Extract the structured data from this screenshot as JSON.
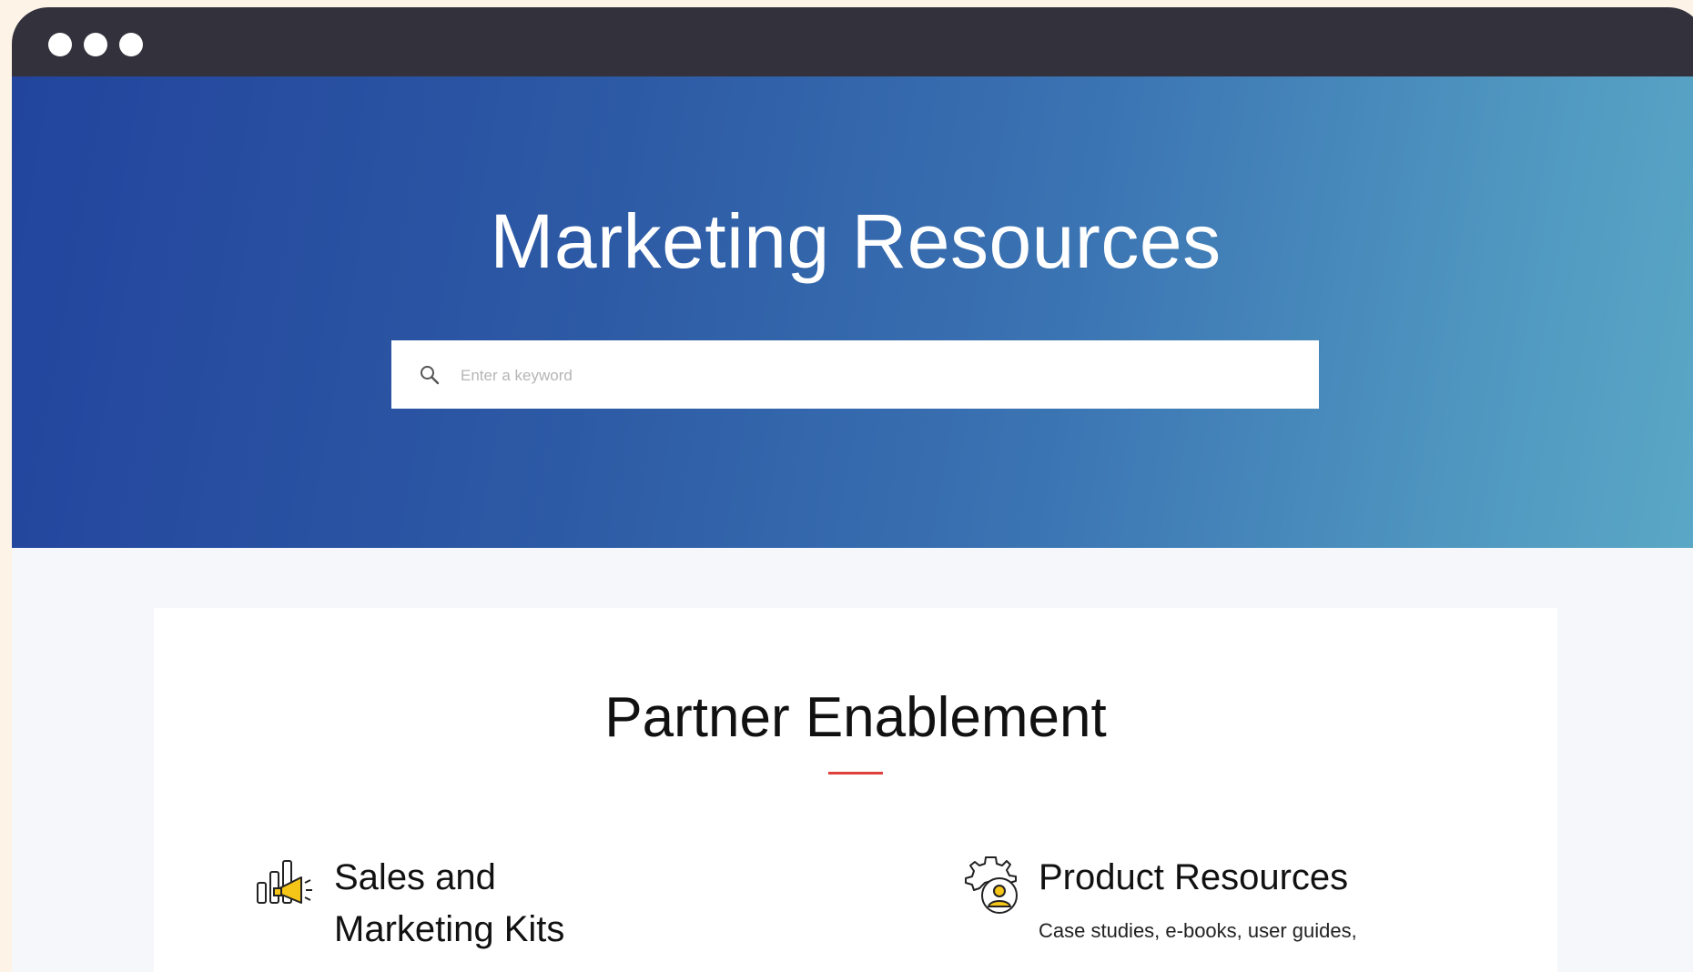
{
  "window": {
    "controls": [
      "close-dot",
      "minimize-dot",
      "maximize-dot"
    ]
  },
  "hero": {
    "title": "Marketing Resources",
    "search": {
      "placeholder": "Enter a keyword",
      "value": "",
      "icon": "search-icon"
    },
    "gradient": [
      "#22449d",
      "#5aa8c6"
    ]
  },
  "section": {
    "title": "Partner Enablement",
    "accent_color": "#e0403c",
    "features": [
      {
        "icon": "megaphone-chart-icon",
        "title_line1": "Sales and",
        "title_line2": "Marketing Kits",
        "description": ""
      },
      {
        "icon": "gear-user-icon",
        "title_line1": "Product Resources",
        "title_line2": "",
        "description": "Case studies, e-books, user guides,"
      }
    ]
  }
}
